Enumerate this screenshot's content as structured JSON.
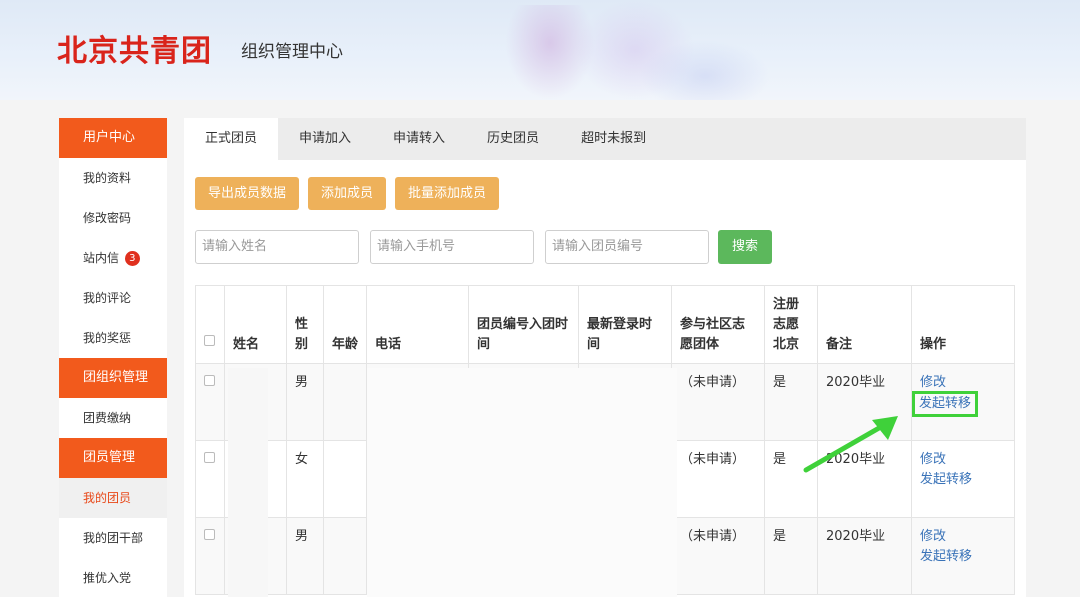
{
  "header": {
    "logo": "北京共青团",
    "subtitle": "组织管理中心"
  },
  "sidebar": {
    "sections": [
      {
        "title": "用户中心",
        "items": [
          "我的资料",
          "修改密码",
          "站内信",
          "我的评论",
          "我的奖惩"
        ]
      },
      {
        "title": "团组织管理",
        "items": [
          "团费缴纳"
        ]
      },
      {
        "title": "团员管理",
        "items": [
          "我的团员",
          "我的团干部",
          "推优入党"
        ]
      }
    ],
    "inbox_badge": "3"
  },
  "tabs": [
    "正式团员",
    "申请加入",
    "申请转入",
    "历史团员",
    "超时未报到"
  ],
  "buttons": {
    "export": "导出成员数据",
    "add": "添加成员",
    "batch_add": "批量添加成员",
    "search": "搜索"
  },
  "search": {
    "name_placeholder": "请输入姓名",
    "phone_placeholder": "请输入手机号",
    "id_placeholder": "请输入团员编号"
  },
  "table": {
    "headers": {
      "name": "姓名",
      "gender": "性别",
      "age": "年龄",
      "phone": "电话",
      "member_id": "团员编号入团时间",
      "last_login": "最新登录时间",
      "community": "参与社区志愿团体",
      "volunteer": "注册志愿北京",
      "note": "备注",
      "ops": "操作"
    },
    "rows": [
      {
        "gender": "男",
        "community": "（未申请）",
        "volunteer": "是",
        "note": "2020毕业",
        "edit": "修改",
        "transfer": "发起转移"
      },
      {
        "gender": "女",
        "community": "（未申请）",
        "volunteer": "是",
        "note": "2020毕业",
        "edit": "修改",
        "transfer": "发起转移"
      },
      {
        "gender": "男",
        "community": "（未申请）",
        "volunteer": "是",
        "note": "2020毕业",
        "edit": "修改",
        "transfer": "发起转移"
      }
    ]
  },
  "colors": {
    "brand_red": "#d9241b",
    "sidebar_orange": "#f25a1c",
    "button_orange": "#eeb15a",
    "search_green": "#5cb85c",
    "link_blue": "#3a73b8",
    "highlight_green": "#3fd13a"
  },
  "icons": [
    "checkbox-icon",
    "arrow-annotation-icon"
  ]
}
